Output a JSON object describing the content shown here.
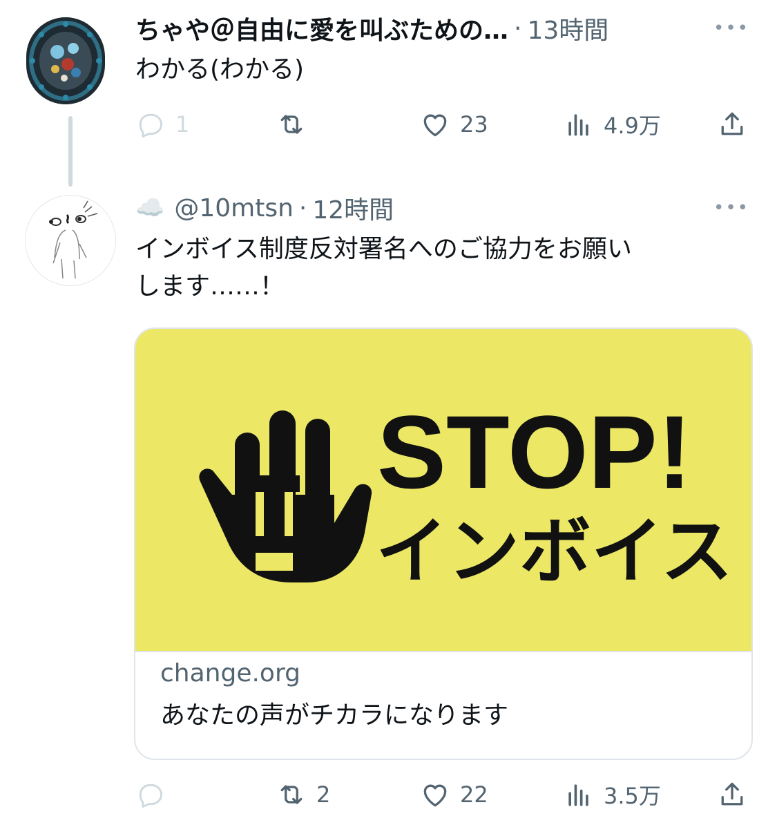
{
  "tweets": [
    {
      "name": "ちゃや＠自由に愛を叫ぶための…",
      "dot": "·",
      "time": "13時間",
      "more": "•••",
      "text": "わかる(わかる)",
      "actions": {
        "reply": "1",
        "retweet": "",
        "like": "23",
        "views": "4.9万"
      }
    },
    {
      "name_emoji": "☁️",
      "handle": "@10mtsn",
      "dot": "·",
      "time": "12時間",
      "more": "•••",
      "text_line1": "インボイス制度反対署名へのご協力をお願い",
      "text_line2": "します……！",
      "card": {
        "image_alt": "STOP! インボイス",
        "logo_line1": "STOP!",
        "logo_line2": "インボイス",
        "domain": "change.org",
        "title": "あなたの声がチカラになります"
      },
      "actions": {
        "reply": "",
        "retweet": "2",
        "like": "22",
        "views": "3.5万"
      }
    }
  ],
  "colors": {
    "text": "#0f1419",
    "secondary": "#536471",
    "card_bg": "#ece866",
    "thread_line": "#cfd9de"
  },
  "icons": [
    "reply-icon",
    "retweet-icon",
    "like-icon",
    "views-icon",
    "share-icon",
    "more-icon"
  ]
}
